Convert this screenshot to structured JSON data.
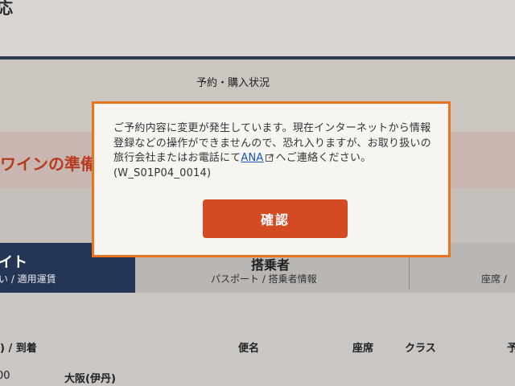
{
  "background": {
    "header_fragment": "応",
    "status_label": "予約・購入状況",
    "banner_fragment": "ワインの準備",
    "tabs": [
      {
        "title": "イト",
        "subtitle": "い / 適用運賃"
      },
      {
        "title": "搭乗者",
        "subtitle": "パスポート / 搭乗者情報"
      },
      {
        "title": "",
        "subtitle": "座席 /"
      }
    ],
    "table": {
      "headers": [
        ") / 到着",
        "便名",
        "座席",
        "クラス",
        "予"
      ],
      "row": {
        "time": "00",
        "destination": "大阪(伊丹)"
      }
    }
  },
  "modal": {
    "message_before_link": "ご予約内容に変更が発生しています。現在インターネットから情報登録などの操作ができませんので、恐れ入りますが、お取り扱いの旅行会社またはお電話にて",
    "link_text": "ANA",
    "message_after_link": "へご連絡ください。(W_S01P04_0014)",
    "confirm_label": "確認"
  },
  "colors": {
    "modal_border": "#e9731f",
    "confirm_button": "#d34a23",
    "link": "#1a55b7",
    "active_tab": "#243556"
  },
  "icons": {
    "external_link": "external-link-icon"
  }
}
